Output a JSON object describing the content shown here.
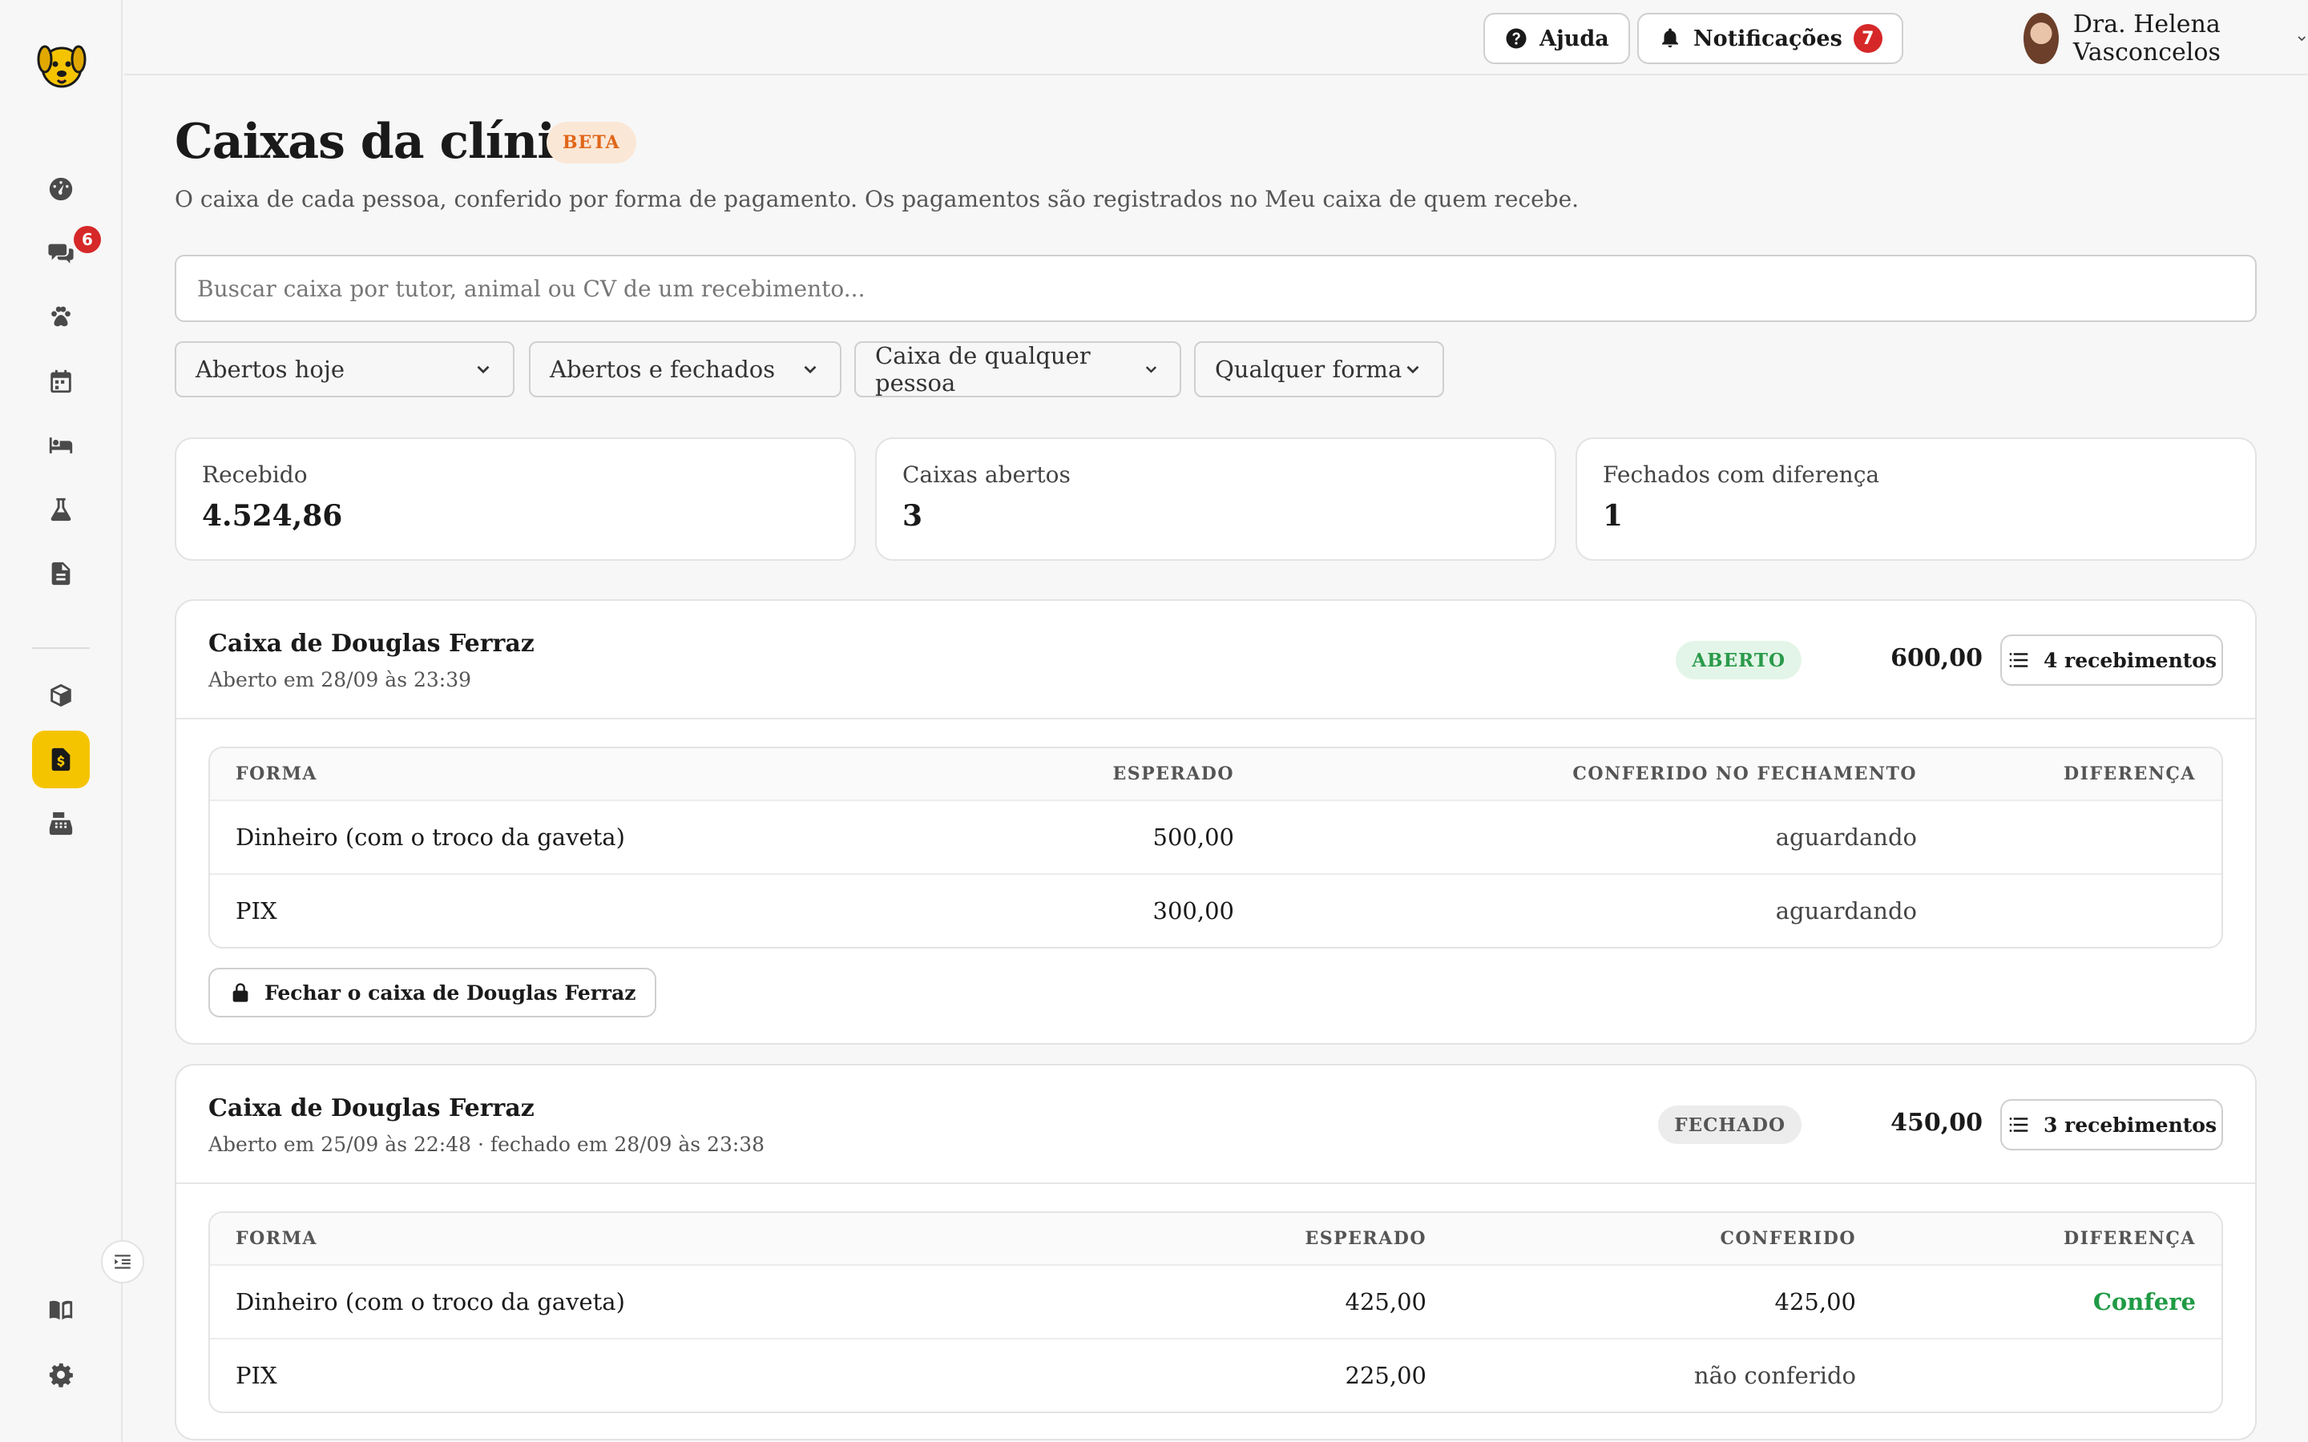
{
  "sidebar": {
    "chat_badge": "6",
    "icons": [
      "dashboard-icon",
      "chat-icon",
      "paw-icon",
      "calendar-icon",
      "bed-icon",
      "flask-icon",
      "document-icon",
      "box-icon",
      "cash-receipt-icon",
      "register-icon",
      "book-icon",
      "gear-icon"
    ]
  },
  "topbar": {
    "help_label": "Ajuda",
    "notifications_label": "Notificações",
    "notifications_count": "7",
    "user_name": "Dra. Helena Vasconcelos"
  },
  "page": {
    "title": "Caixas da clínica",
    "badge": "BETA",
    "subtitle": "O caixa de cada pessoa, conferido por forma de pagamento. Os pagamentos são registrados no Meu caixa de quem recebe."
  },
  "search": {
    "placeholder": "Buscar caixa por tutor, animal ou CV de um recebimento...",
    "value": ""
  },
  "filters": {
    "period": "Abertos hoje",
    "state": "Abertos e fechados",
    "person": "Caixa de qualquer pessoa",
    "method": "Qualquer forma"
  },
  "stats": [
    {
      "label": "Recebido",
      "value": "4.524,86"
    },
    {
      "label": "Caixas abertos",
      "value": "3"
    },
    {
      "label": "Fechados com diferença",
      "value": "1"
    }
  ],
  "cards": [
    {
      "title": "Caixa de Douglas Ferraz",
      "subtitle": "Aberto em 28/09 às 23:39",
      "status": "ABERTO",
      "amount": "600,00",
      "receipts_label": "4 recebimentos",
      "columns": [
        "FORMA",
        "ESPERADO",
        "CONFERIDO NO FECHAMENTO",
        "DIFERENÇA"
      ],
      "rows": [
        {
          "method": "Dinheiro (com o troco da gaveta)",
          "expected": "500,00",
          "checked": "aguardando",
          "diff": ""
        },
        {
          "method": "PIX",
          "expected": "300,00",
          "checked": "aguardando",
          "diff": ""
        }
      ],
      "close_label": "Fechar o caixa de Douglas Ferraz"
    },
    {
      "title": "Caixa de Douglas Ferraz",
      "subtitle": "Aberto em 25/09 às 22:48 · fechado em 28/09 às 23:38",
      "status": "FECHADO",
      "amount": "450,00",
      "receipts_label": "3 recebimentos",
      "columns": [
        "FORMA",
        "ESPERADO",
        "CONFERIDO",
        "DIFERENÇA"
      ],
      "rows": [
        {
          "method": "Dinheiro (com o troco da gaveta)",
          "expected": "425,00",
          "checked": "425,00",
          "diff": "Confere"
        },
        {
          "method": "PIX",
          "expected": "225,00",
          "checked": "não conferido",
          "diff": ""
        }
      ]
    }
  ],
  "colors": {
    "accent": "#f5c400",
    "danger": "#d62828",
    "success": "#1f9a45",
    "beta": "#e0671a"
  }
}
